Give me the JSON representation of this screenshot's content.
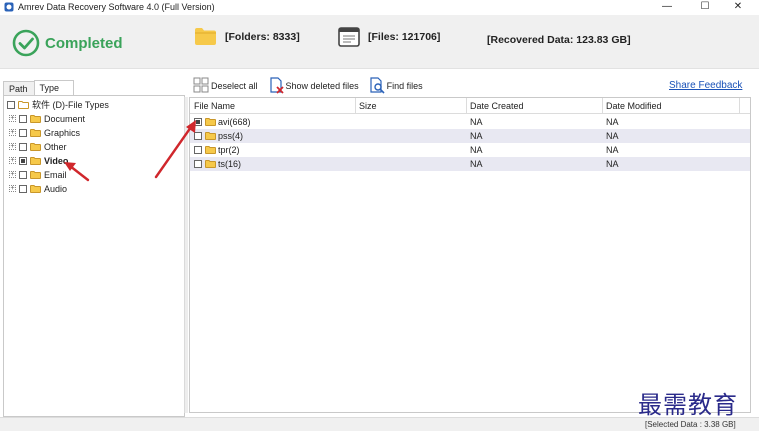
{
  "window": {
    "title": "Amrev Data Recovery Software 4.0 (Full Version)",
    "controls": {
      "minimize": "—",
      "maximize": "☐",
      "close": "✕"
    }
  },
  "status": {
    "completed_label": "Completed",
    "folders_label": "[Folders: 8333]",
    "files_label": "[Files: 121706]",
    "recovered_label": "[Recovered Data: 123.83 GB]"
  },
  "tree_panel": {
    "tabs": [
      "Path",
      "Type"
    ],
    "active_tab": "Type",
    "root_label": "软件 (D)-File Types",
    "items": [
      {
        "label": "Document",
        "checked": "none"
      },
      {
        "label": "Graphics",
        "checked": "none"
      },
      {
        "label": "Other",
        "checked": "none"
      },
      {
        "label": "Video",
        "checked": "partial",
        "selected": true
      },
      {
        "label": "Email",
        "checked": "none"
      },
      {
        "label": "Audio",
        "checked": "none"
      }
    ]
  },
  "toolbar": {
    "deselect_all": "Deselect all",
    "show_deleted": "Show deleted files",
    "find_files": "Find files",
    "share_feedback": "Share Feedback"
  },
  "grid": {
    "columns": [
      "File Name",
      "Size",
      "Date Created",
      "Date Modified"
    ],
    "rows": [
      {
        "name": "avi(668)",
        "size": "",
        "created": "NA",
        "modified": "NA",
        "checked": "partial"
      },
      {
        "name": "pss(4)",
        "size": "",
        "created": "NA",
        "modified": "NA",
        "checked": "none"
      },
      {
        "name": "tpr(2)",
        "size": "",
        "created": "NA",
        "modified": "NA",
        "checked": "none"
      },
      {
        "name": "ts(16)",
        "size": "",
        "created": "NA",
        "modified": "NA",
        "checked": "none"
      }
    ]
  },
  "footer": {
    "selected_data": "[Selected Data : 3.38 GB]"
  },
  "watermark": "最需教育",
  "colors": {
    "completed_green": "#3aa35a",
    "folder_yellow": "#f6c94a",
    "link_blue": "#1a52b8",
    "arrow_red": "#d0272c",
    "alt_row": "#e8e8f2"
  },
  "icons": [
    "app-icon",
    "check-circle-icon",
    "folder-icon",
    "document-icon",
    "deselect-icon",
    "show-deleted-icon",
    "find-files-icon",
    "expander-icon",
    "red-arrow-annotation"
  ]
}
